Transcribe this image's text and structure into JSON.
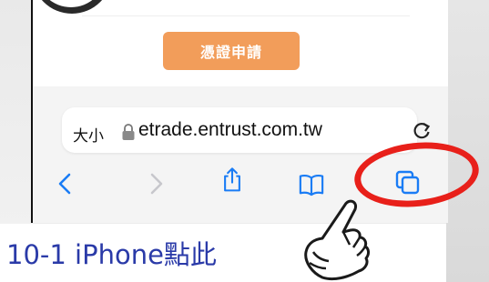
{
  "page": {
    "apply_button": "憑證申請",
    "caption": "10-1 iPhone點此"
  },
  "browser": {
    "text_size_label": "大小",
    "url": "etrade.entrust.com.tw",
    "toolbar": {
      "back": "chevron-left-icon",
      "forward": "chevron-right-icon",
      "share": "share-icon",
      "bookmarks": "book-icon",
      "tabs": "tabs-icon"
    },
    "accent_color": "#1a7cf5"
  },
  "annotation": {
    "highlight_color": "#e8201a",
    "caption_color": "#2a3aa8",
    "button_color": "#f29d5a"
  }
}
